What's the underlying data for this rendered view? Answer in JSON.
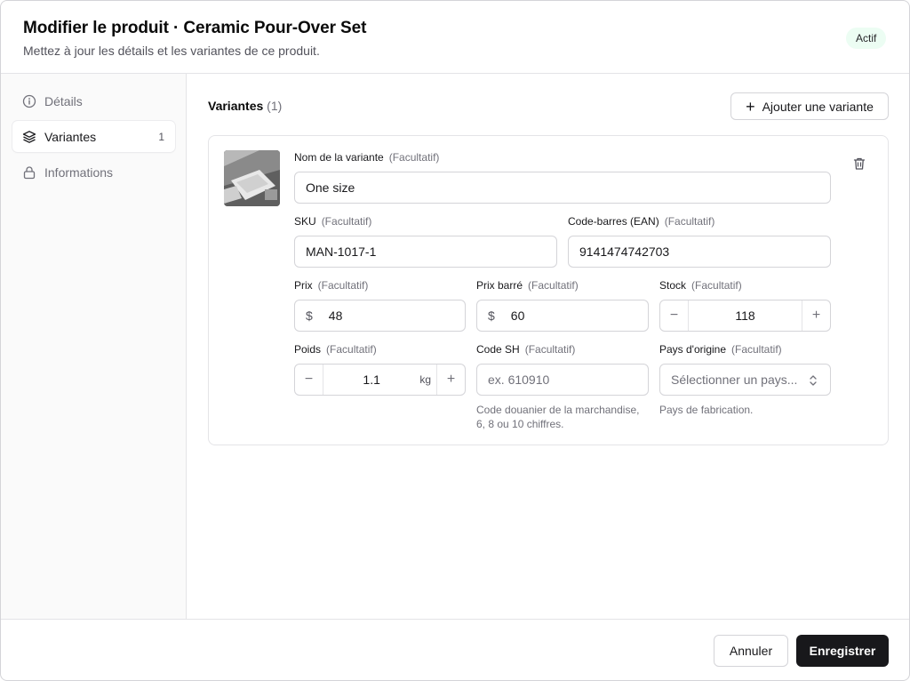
{
  "header": {
    "title": "Modifier le produit · Ceramic Pour-Over Set",
    "subtitle": "Mettez à jour les détails et les variantes de ce produit.",
    "status_badge": "Actif"
  },
  "sidebar": {
    "items": [
      {
        "label": "Détails",
        "icon": "info-icon",
        "active": false
      },
      {
        "label": "Variantes",
        "icon": "layers-icon",
        "active": true,
        "count": "1"
      },
      {
        "label": "Informations",
        "icon": "lock-icon",
        "active": false
      }
    ]
  },
  "main": {
    "section_title": "Variantes",
    "section_count": "(1)",
    "add_variant_label": "Ajouter une variante",
    "variant": {
      "name": {
        "label": "Nom de la variante",
        "optional": "(Facultatif)",
        "value": "One size"
      },
      "sku": {
        "label": "SKU",
        "optional": "(Facultatif)",
        "value": "MAN-1017-1"
      },
      "barcode": {
        "label": "Code-barres (EAN)",
        "optional": "(Facultatif)",
        "value": "9141474742703"
      },
      "price": {
        "label": "Prix",
        "optional": "(Facultatif)",
        "currency": "$",
        "value": "48"
      },
      "compare_price": {
        "label": "Prix barré",
        "optional": "(Facultatif)",
        "currency": "$",
        "value": "60"
      },
      "stock": {
        "label": "Stock",
        "optional": "(Facultatif)",
        "value": "118",
        "minus": "−",
        "plus": "+"
      },
      "weight": {
        "label": "Poids",
        "optional": "(Facultatif)",
        "value": "1.1",
        "unit": "kg",
        "minus": "−",
        "plus": "+"
      },
      "hs_code": {
        "label": "Code SH",
        "optional": "(Facultatif)",
        "placeholder": "ex. 610910",
        "help_line1": "Code douanier de la marchandise,",
        "help_line2": "6, 8 ou 10 chiffres."
      },
      "country": {
        "label": "Pays d'origine",
        "optional": "(Facultatif)",
        "placeholder": "Sélectionner un pays...",
        "help": "Pays de fabrication."
      }
    }
  },
  "footer": {
    "cancel_label": "Annuler",
    "save_label": "Enregistrer"
  },
  "colors": {
    "primary": "#18181b",
    "badge_bg": "#ecfdf3",
    "border": "#d4d4d8"
  }
}
